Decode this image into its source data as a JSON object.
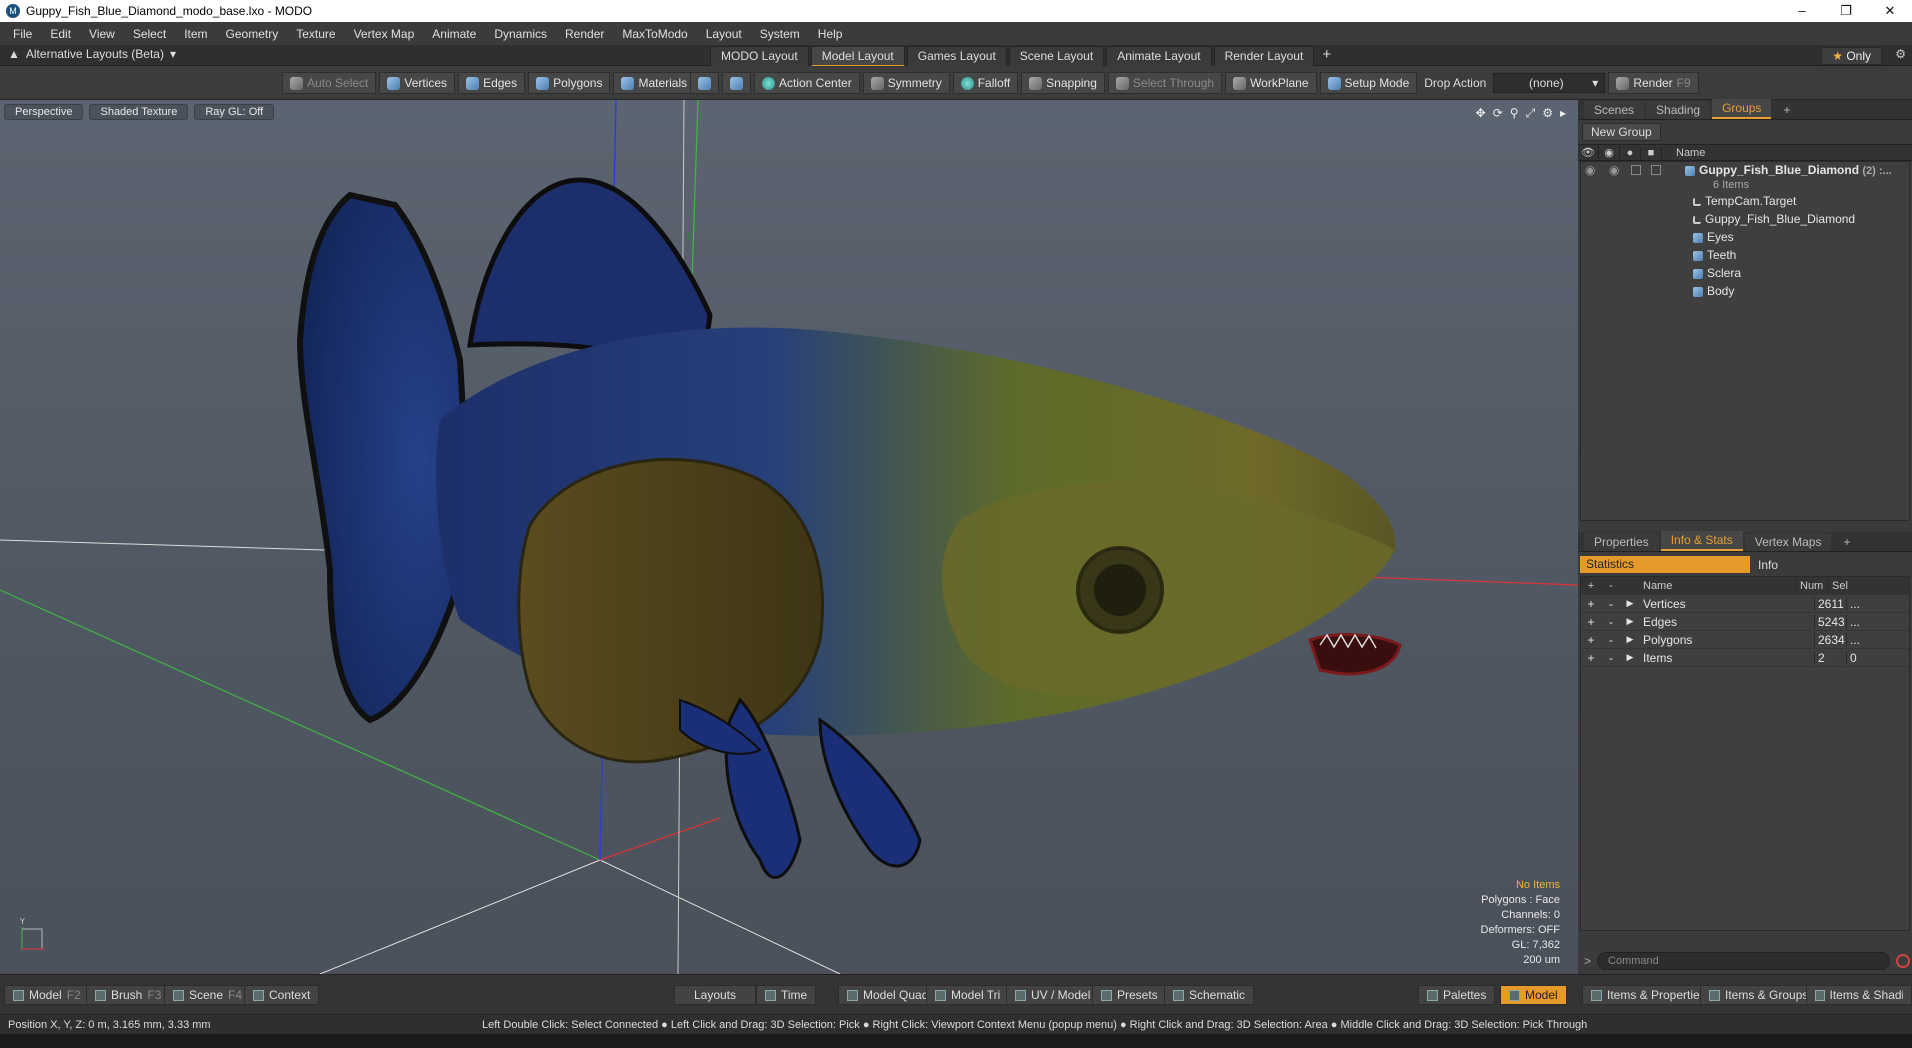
{
  "window": {
    "title": "Guppy_Fish_Blue_Diamond_modo_base.lxo - MODO",
    "app_letter": "M"
  },
  "menu": [
    "File",
    "Edit",
    "View",
    "Select",
    "Item",
    "Geometry",
    "Texture",
    "Vertex Map",
    "Animate",
    "Dynamics",
    "Render",
    "MaxToModo",
    "Layout",
    "System",
    "Help"
  ],
  "layoutbar": {
    "alt_label": "Alternative Layouts (Beta)",
    "tabs": [
      "MODO Layout",
      "Model Layout",
      "Games Layout",
      "Scene Layout",
      "Animate Layout",
      "Render Layout"
    ],
    "active_tab": "Model Layout",
    "only_label": "Only"
  },
  "toolbar": {
    "auto_select": "Auto Select",
    "vertices": "Vertices",
    "edges": "Edges",
    "polygons": "Polygons",
    "materials": "Materials",
    "action_center": "Action Center",
    "symmetry": "Symmetry",
    "falloff": "Falloff",
    "snapping": "Snapping",
    "select_through": "Select Through",
    "workplane": "WorkPlane",
    "setup_mode": "Setup Mode",
    "drop_action": "Drop Action",
    "drop_value": "(none)",
    "render": "Render",
    "render_key": "F9"
  },
  "viewport": {
    "view": "Perspective",
    "shading": "Shaded Texture",
    "raygl": "Ray GL: Off",
    "info": {
      "selection": "No Items",
      "polygons": "Polygons : Face",
      "channels": "Channels: 0",
      "deformers": "Deformers: OFF",
      "gl": "GL: 7,362",
      "scale": "200 um"
    },
    "gizmo_label": "Y"
  },
  "groups_panel": {
    "tabs": [
      "Scenes",
      "Shading",
      "Groups"
    ],
    "active": "Groups",
    "new_group": "New Group",
    "col_name": "Name",
    "root": {
      "name": "Guppy_Fish_Blue_Diamond",
      "count": "(2) :...",
      "sub": "6 Items"
    },
    "items": [
      "TempCam.Target",
      "Guppy_Fish_Blue_Diamond",
      "Eyes",
      "Teeth",
      "Sclera",
      "Body"
    ]
  },
  "info_panel": {
    "tabs": [
      "Properties",
      "Info & Stats",
      "Vertex Maps"
    ],
    "active": "Info & Stats",
    "statistics": "Statistics",
    "info": "Info",
    "cols": {
      "name": "Name",
      "num": "Num",
      "sel": "Sel"
    },
    "rows": [
      {
        "name": "Vertices",
        "num": "2611",
        "sel": "..."
      },
      {
        "name": "Edges",
        "num": "5243",
        "sel": "..."
      },
      {
        "name": "Polygons",
        "num": "2634",
        "sel": "..."
      },
      {
        "name": "Items",
        "num": "2",
        "sel": "0"
      }
    ],
    "command_placeholder": "Command"
  },
  "bottombar": {
    "model": "Model",
    "model_key": "F2",
    "brush": "Brush",
    "brush_key": "F3",
    "scene": "Scene",
    "scene_key": "F4",
    "context": "Context",
    "layouts": "Layouts",
    "time": "Time",
    "model_quad": "Model Quad",
    "model_tri": "Model Tri",
    "uv_model": "UV / Model",
    "presets": "Presets",
    "schematic": "Schematic",
    "palettes": "Palettes",
    "model_right": "Model",
    "items_properties": "Items & Properties",
    "items_groups": "Items & Groups",
    "items_shading": "Items & Shading"
  },
  "statusbar": {
    "position": "Position X, Y, Z:   0 m, 3.165 mm, 3.33 mm",
    "hint": "Left Double Click: Select Connected ● Left Click and Drag: 3D Selection: Pick ● Right Click: Viewport Context Menu (popup menu) ● Right Click and Drag: 3D Selection: Area ● Middle Click and Drag: 3D Selection: Pick Through"
  },
  "colors": {
    "accent": "#e69a2a",
    "viewport_bg": "#565e69"
  }
}
